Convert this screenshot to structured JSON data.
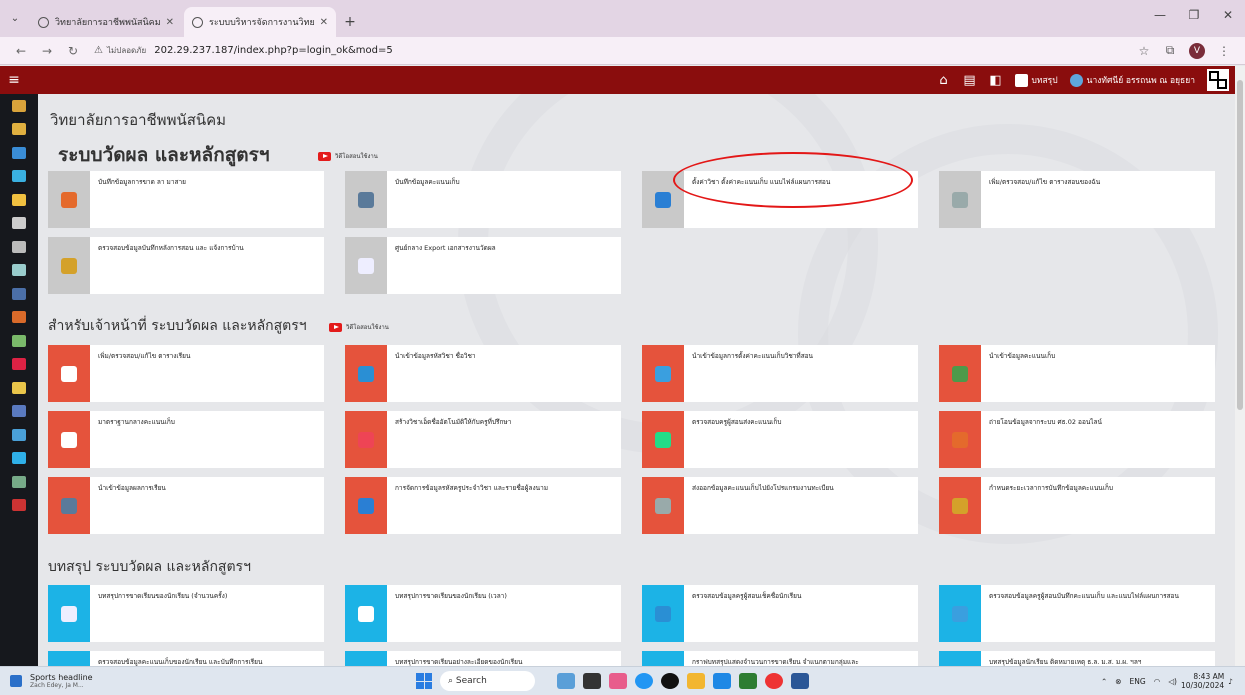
{
  "browser": {
    "tabs": [
      {
        "title": "วิทยาลัยการอาชีพพนัสนิคม : Phana"
      },
      {
        "title": "ระบบบริหารจัดการงานวิทยาลัยการอ"
      }
    ],
    "url_security": "ไม่ปลอดภัย",
    "url": "202.29.237.187/index.php?p=login_ok&mod=5",
    "profile_initial": "V"
  },
  "header": {
    "summary_label": "บทสรุป",
    "user_name": "นางทัศนีย์ อรรถนพ ณ อยุธยา"
  },
  "content": {
    "college_name": "วิทยาลัยการอาชีพพนัสนิคม",
    "section1": {
      "title": "ระบบวัดผล และหลักสูตรฯ",
      "video_label": "วิดีโอสอนใช้งาน",
      "cards": [
        {
          "label": "บันทึกข้อมูลการขาด ลา มาสาย"
        },
        {
          "label": "บันทึกข้อมูลคะแนนเก็บ"
        },
        {
          "label": "ตั้งค่าวิชา ตั้งค่าคะแนนเก็บ แนบไฟล์แผนการสอน"
        },
        {
          "label": "เพิ่ม/ตรวจสอบ/แก้ไข ตารางสอนของฉัน"
        },
        {
          "label": "ตรวจสอบข้อมูลบันทึกหลังการสอน และ แจ้งการบ้าน"
        },
        {
          "label": "ศูนย์กลาง Export เอกสารงานวัดผล"
        }
      ]
    },
    "section2": {
      "title": "สำหรับเจ้าหน้าที่ ระบบวัดผล และหลักสูตรฯ",
      "video_label": "วิดีโอสอนใช้งาน",
      "cards": [
        {
          "label": "เพิ่ม/ตรวจสอบ/แก้ไข ตารางเรียน"
        },
        {
          "label": "นำเข้าข้อมูลรหัสวิชา ชื่อวิชา"
        },
        {
          "label": "นำเข้าข้อมูลการตั้งค่าคะแนนเก็บวิชาที่สอน"
        },
        {
          "label": "นำเข้าข้อมูลคะแนนเก็บ"
        },
        {
          "label": "มาตราฐานกลางคะแนนเก็บ"
        },
        {
          "label": "สร้างวิชาเอ็ดชื่ออัตโนมัติให้กับครูที่ปรึกษา"
        },
        {
          "label": "ตรวจสอบครูผู้สอนส่งคะแนนเก็บ"
        },
        {
          "label": "ถ่ายโอนข้อมูลจากระบบ ศธ.02 ออนไลน์"
        },
        {
          "label": "นำเข้าข้อมูลผลการเรียน"
        },
        {
          "label": "การจัดการข้อมูลรหัสครูประจำวิชา และรายชื่อผู้ลงนาม"
        },
        {
          "label": "ส่งออกข้อมูลคะแนนเก็บไปยังโปรแกรมงานทะเบียน"
        },
        {
          "label": "กำหนดระยะเวลาการบันทึกข้อมูลคะแนนเก็บ"
        }
      ]
    },
    "section3": {
      "title": "บทสรุป ระบบวัดผล และหลักสูตรฯ",
      "cards": [
        {
          "label": "บทสรุปการขาดเรียนของนักเรียน (จำนวนครั้ง)"
        },
        {
          "label": "บทสรุปการขาดเรียนของนักเรียน (เวลา)"
        },
        {
          "label": "ตรวจสอบข้อมูลครูผู้สอนเช็คชื่อนักเรียน"
        },
        {
          "label": "ตรวจสอบข้อมูลครูผู้สอนบันทึกคะแนนเก็บ และแนบไฟล์แผนการสอน"
        },
        {
          "label": "ตรวจสอบข้อมูลคะแนนเก็บของนักเรียน และบันทึกการเรียน"
        },
        {
          "label": "บทสรุปการขาดเรียนอย่างละเอียดของนักเรียน"
        },
        {
          "label": "กราฟบทสรุปแสดงจำนวนการขาดเรียน จำแนกตามกลุ่มและ"
        },
        {
          "label": "บทสรุปข้อมูลนักเรียน ติดหมายเหตุ ธ.ล. ม.ส. ม.ผ. ฯลฯ"
        }
      ]
    }
  },
  "taskbar": {
    "news_title": "Sports headline",
    "news_sub": "Zach Edey, Ja M...",
    "search_placeholder": "Search",
    "lang": "ENG",
    "time": "8:43 AM",
    "date": "10/30/2024"
  }
}
